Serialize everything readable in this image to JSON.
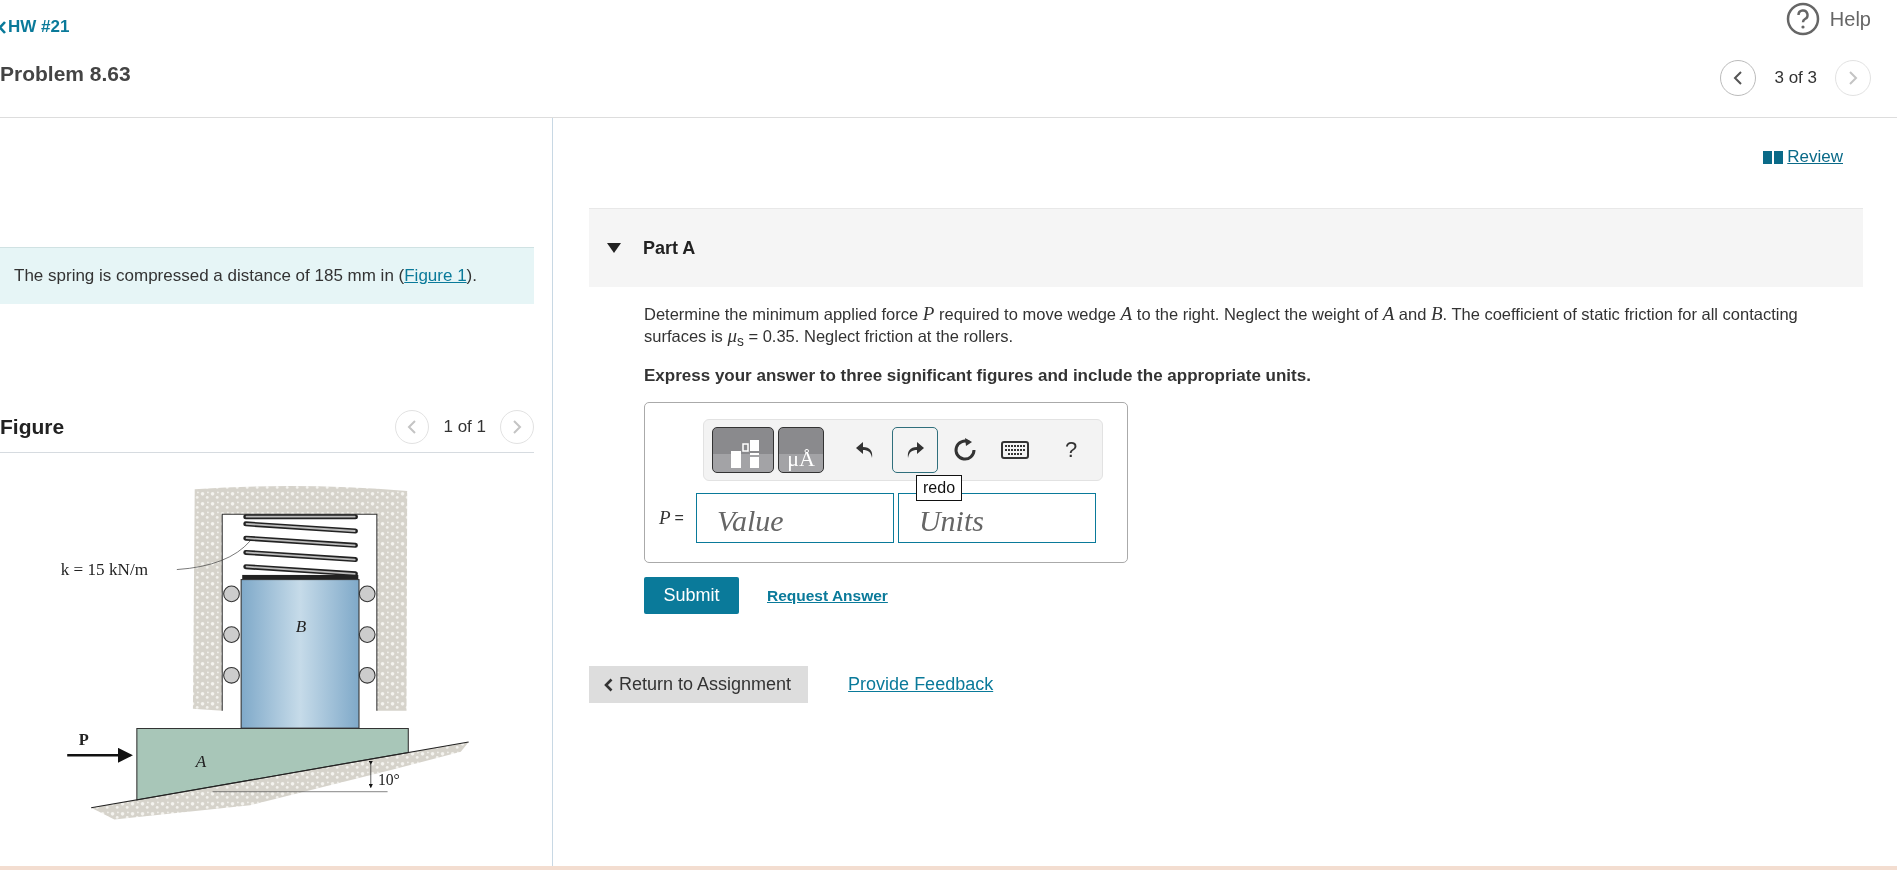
{
  "header": {
    "back_link": "HW #21",
    "title": "Problem 8.63",
    "help": "Help",
    "pager": {
      "text": "3 of 3",
      "prev_disabled": false,
      "next_disabled": true
    }
  },
  "intro": {
    "before": "The spring is compressed a distance of 185 mm in (",
    "link": "Figure 1",
    "after": ")."
  },
  "figure": {
    "title": "Figure",
    "pager": {
      "text": "1 of 1",
      "prev_disabled": true,
      "next_disabled": true
    },
    "spring_label": "k = 15 kN/m",
    "block_label": "B",
    "force_label": "P",
    "wedge_label": "A",
    "angle_label": "10°"
  },
  "review": "Review",
  "part": {
    "title": "Part A",
    "expanded": true,
    "question": "Determine the minimum applied force *P* required to move wedge *A* to the right. Neglect the weight of *A* and *B*. The coefficient of static friction for all contacting surfaces is *μ*$_{s}$ = 0.35. Neglect friction at the rollers.",
    "instruction": "Express your answer to three significant figures and include the appropriate units.",
    "toolbar": [
      {
        "kind": "templates",
        "focused": false
      },
      {
        "kind": "units",
        "text": "μÅ",
        "focused": false
      },
      {
        "kind": "undo",
        "focused": false
      },
      {
        "kind": "redo",
        "focused": true
      },
      {
        "kind": "reset",
        "focused": false
      },
      {
        "kind": "keyboard",
        "focused": false
      },
      {
        "kind": "help",
        "text": "?",
        "focused": false
      }
    ],
    "tooltip": "redo",
    "variable": "P",
    "equals": "=",
    "value_placeholder": "Value",
    "units_placeholder": "Units",
    "submit": "Submit",
    "request": "Request Answer"
  },
  "footer": {
    "return": "Return to Assignment",
    "feedback": "Provide Feedback"
  }
}
